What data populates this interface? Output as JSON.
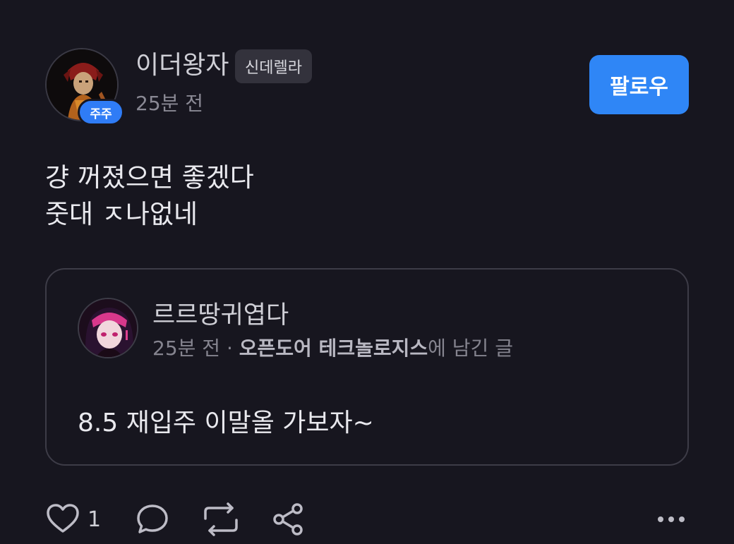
{
  "post": {
    "author": {
      "name": "이더왕자",
      "rank_badge": "신데렐라",
      "avatar_badge": "주주",
      "time": "25분 전"
    },
    "follow_label": "팔로우",
    "body_lines": [
      "걍 꺼졌으면 좋겠다",
      "줏대 ㅈ나없네"
    ],
    "quote": {
      "author_name": "르르땅귀엽다",
      "time": "25분 전",
      "separator": " · ",
      "community": "오픈도어 테크놀로지스",
      "suffix": "에 남긴 글",
      "text": "8.5 재입주 이말올 가보자~"
    },
    "actions": {
      "like_count": "1",
      "icons": [
        "heart-icon",
        "comment-icon",
        "repost-icon",
        "share-icon",
        "more-icon"
      ]
    }
  },
  "colors": {
    "background": "#17161f",
    "accent": "#2f86f6",
    "muted": "#85848f",
    "border": "#3d3c47"
  }
}
